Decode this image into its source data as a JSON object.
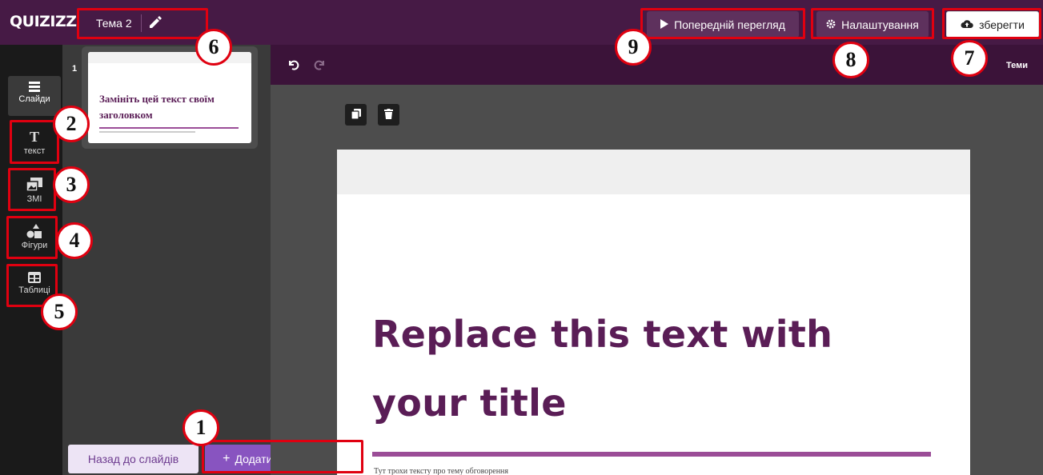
{
  "header": {
    "logo": "QUIZIZZ",
    "theme_title": "Тема 2",
    "preview_label": "Попередній перегляд",
    "settings_label": "Налаштування",
    "save_label": "зберегти"
  },
  "toolbar": {
    "themes_label": "Теми"
  },
  "sidebar": {
    "items": [
      {
        "label": "Слайди",
        "icon": "slides-icon"
      },
      {
        "label": "текст",
        "icon": "text-icon"
      },
      {
        "label": "ЗМІ",
        "icon": "media-icon"
      },
      {
        "label": "Фігури",
        "icon": "shapes-icon"
      },
      {
        "label": "Таблиці",
        "icon": "table-icon"
      }
    ]
  },
  "slides_panel": {
    "slide_number": "1",
    "thumbnail_title": "Замініть цей текст своїм заголовком",
    "back_label": "Назад до слайдів",
    "add_label": "Додати новий слайд"
  },
  "slide": {
    "title": "Replace this text with your title",
    "subtitle": "Тут трохи тексту про тему обговорення"
  },
  "callouts": [
    "1",
    "2",
    "3",
    "4",
    "5",
    "6",
    "7",
    "8",
    "9"
  ],
  "colors": {
    "topbar": "#461a45",
    "accent": "#8854c0",
    "annotation": "#e00010",
    "title_text": "#5a1d56"
  }
}
